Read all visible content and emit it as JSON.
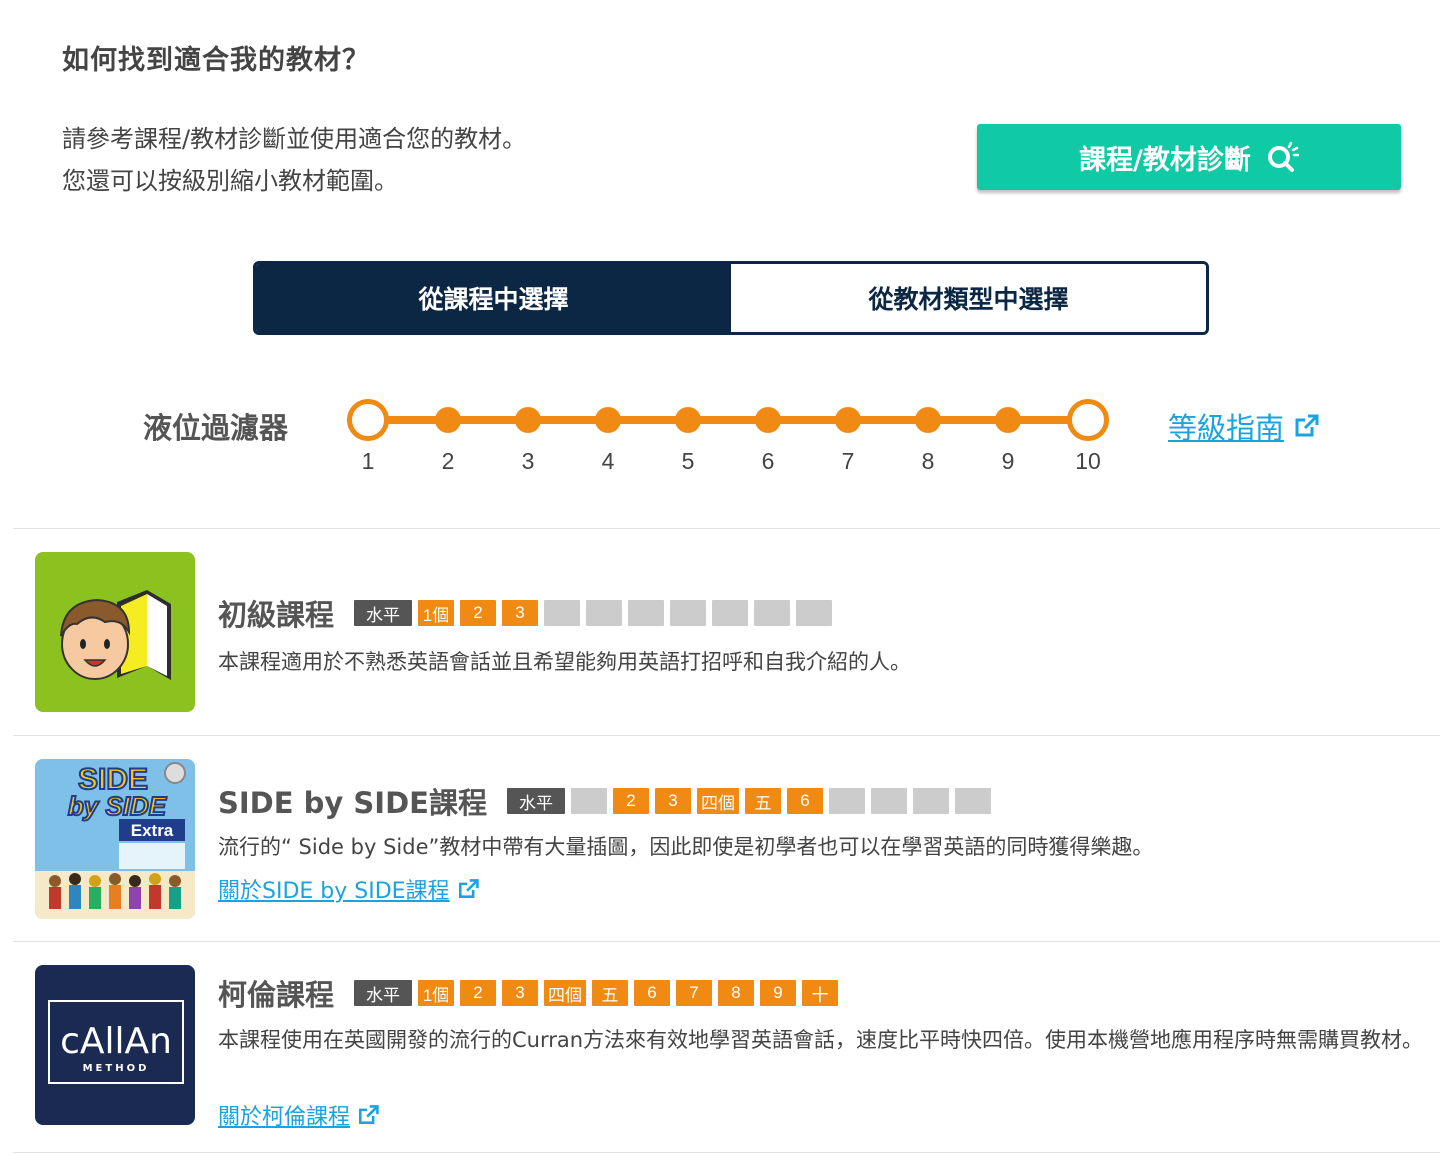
{
  "header": {
    "title": "如何找到適合我的教材？",
    "intro_line1": "請參考課程/教材診斷並使用適合您的教材。",
    "intro_line2": "您還可以按級別縮小教材範圍。",
    "diagnosis_button": "課程/教材診斷",
    "diagnosis_icon": "search-sparkle-icon"
  },
  "tabs": [
    {
      "label": "從課程中選擇",
      "active": true
    },
    {
      "label": "從教材類型中選擇",
      "active": false
    }
  ],
  "filter": {
    "label": "液位過濾器",
    "ticks": [
      "1",
      "2",
      "3",
      "4",
      "5",
      "6",
      "7",
      "8",
      "9",
      "10"
    ],
    "range": [
      1,
      10
    ],
    "accent": "#f08a12",
    "guide_link": "等級指南"
  },
  "courses": [
    {
      "title": "初級課程",
      "level_label": "水平",
      "levels": [
        "1個",
        "2",
        "3",
        "",
        "",
        "",
        "",
        "",
        "",
        ""
      ],
      "description": "本課程適用於不熟悉英語會話並且希望能夠用英語打招呼和自我介紹的人。",
      "link": ""
    },
    {
      "title": "SIDE by SIDE課程",
      "level_label": "水平",
      "levels": [
        "",
        "2",
        "3",
        "四個",
        "五",
        "6",
        "",
        "",
        "",
        ""
      ],
      "description": "流行的“ Side by Side”教材中帶有大量插圖，因此即使是初學者也可以在學習英語的同時獲得樂趣。",
      "link": "關於SIDE by SIDE課程",
      "thumb_text": {
        "line1": "SIDE",
        "line2": "by SIDE",
        "line3": "Extra"
      }
    },
    {
      "title": "柯倫課程",
      "level_label": "水平",
      "levels": [
        "1個",
        "2",
        "3",
        "四個",
        "五",
        "6",
        "7",
        "8",
        "9",
        "十"
      ],
      "description": "本課程使用在英國開發的流行的Curran方法來有效地學習英語會話，速度比平時快四倍。使用本機營地應用程序時無需購買教材。",
      "link": "關於柯倫課程",
      "thumb_text": {
        "line1": "cAllAn",
        "line2": "METHOD"
      }
    }
  ],
  "colors": {
    "teal": "#10c9a5",
    "navy": "#0c2744",
    "orange": "#f08a12",
    "link": "#1aa3e0"
  }
}
